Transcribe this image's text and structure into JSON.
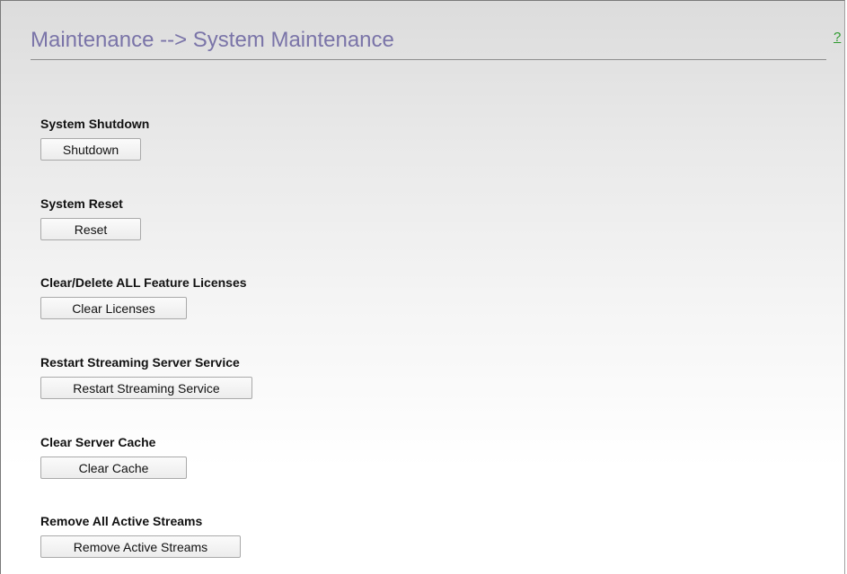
{
  "header": {
    "title": "Maintenance --> System Maintenance",
    "help_label": "?"
  },
  "sections": [
    {
      "label": "System Shutdown",
      "button": "Shutdown"
    },
    {
      "label": "System Reset",
      "button": "Reset"
    },
    {
      "label": "Clear/Delete ALL Feature Licenses",
      "button": "Clear Licenses"
    },
    {
      "label": "Restart Streaming Server Service",
      "button": "Restart Streaming Service"
    },
    {
      "label": "Clear Server Cache",
      "button": "Clear Cache"
    },
    {
      "label": "Remove All Active Streams",
      "button": "Remove Active Streams"
    }
  ],
  "colors": {
    "title": "#7a74a8",
    "help_link": "#2e9a2e",
    "background_top": "#dcdcdc",
    "background_bottom": "#ffffff"
  }
}
